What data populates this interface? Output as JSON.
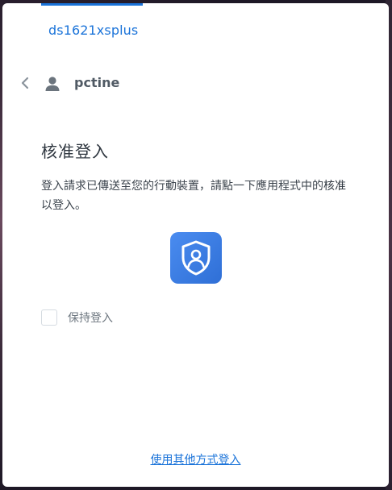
{
  "header": {
    "server_name": "ds1621xsplus"
  },
  "account": {
    "username": "pctine"
  },
  "main": {
    "title": "核准登入",
    "description_part1": "登入請求已傳送至您的行動裝置，請點一下應用程式中的",
    "description_highlight": "核准",
    "description_part2": "以登入。"
  },
  "options": {
    "keep_signed_in_label": "保持登入",
    "keep_signed_in_checked": false
  },
  "footer": {
    "other_method_link": "使用其他方式登入"
  },
  "icons": {
    "back": "chevron-left-icon",
    "user": "user-icon",
    "app": "secure-signin-app-icon"
  },
  "colors": {
    "accent": "#1a73d9",
    "app_icon_bg": "#3a7be0"
  }
}
